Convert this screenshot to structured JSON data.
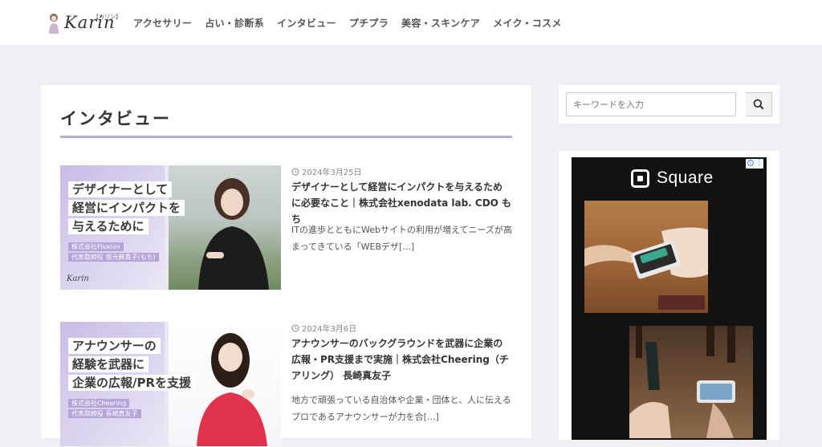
{
  "header": {
    "logo_text": "Karin",
    "logo_kana": "【カリン】",
    "nav": [
      {
        "label": "アクセサリー"
      },
      {
        "label": "占い・診断系"
      },
      {
        "label": "インタビュー"
      },
      {
        "label": "プチプラ"
      },
      {
        "label": "美容・スキンケア"
      },
      {
        "label": "メイク・コスメ"
      }
    ]
  },
  "main": {
    "page_title": "インタビュー",
    "articles": [
      {
        "date": "2024年3月25日",
        "title": "デザイナーとして経営にインパクトを与えるために必要なこと｜株式会社xenodata lab. CDO もち",
        "excerpt": "ITの進歩とともにWebサイトの利用が増えてニーズが高まってきている「WEBデザ[...]",
        "thumb": {
          "lines": [
            "デザイナーとして",
            "経営にインパクトを",
            "与えるために"
          ],
          "company": "株式会社Fluxion",
          "role": "代表取締役 坂元麻貴子(もち)",
          "signature": "Karin"
        }
      },
      {
        "date": "2024年3月6日",
        "title": "アナウンサーのバックグラウンドを武器に企業の広報・PR支援まで実施｜株式会社Cheering（チアリング） 長崎真友子",
        "excerpt": "地方で頑張っている自治体や企業・団体と、人に伝えるプロであるアナウンサーが力を合[...]",
        "thumb": {
          "lines": [
            "アナウンサーの",
            "経験を武器に",
            "企業の広報/PRを支援"
          ],
          "company": "株式会社Cheering",
          "role": "代表取締役 長崎真友子"
        }
      }
    ]
  },
  "sidebar": {
    "search": {
      "placeholder": "キーワードを入力"
    },
    "ad": {
      "brand": "Square"
    }
  },
  "colors": {
    "accent": "#b8a9d9",
    "page_bg": "#f0eff4"
  }
}
